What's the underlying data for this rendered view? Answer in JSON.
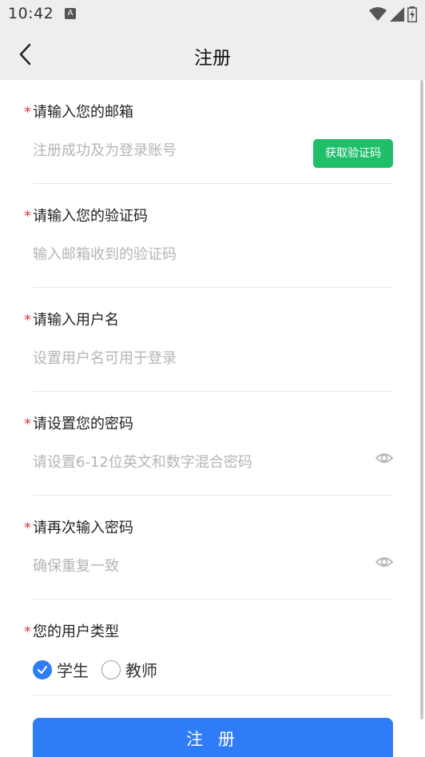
{
  "status_bar": {
    "time": "10:42",
    "notification_icon": "A"
  },
  "app_bar": {
    "title": "注册"
  },
  "form": {
    "required_mark": "*",
    "email": {
      "label": "请输入您的邮箱",
      "placeholder": "注册成功及为登录账号",
      "value": ""
    },
    "get_code_button": "获取验证码",
    "code": {
      "label": "请输入您的验证码",
      "placeholder": "输入邮箱收到的验证码",
      "value": ""
    },
    "username": {
      "label": "请输入用户名",
      "placeholder": "设置用户名可用于登录",
      "value": ""
    },
    "password": {
      "label": "请设置您的密码",
      "placeholder": "请设置6-12位英文和数字混合密码",
      "value": ""
    },
    "confirm": {
      "label": "请再次输入密码",
      "placeholder": "确保重复一致",
      "value": ""
    },
    "user_type": {
      "label": "您的用户类型",
      "options": [
        {
          "label": "学生",
          "checked": true
        },
        {
          "label": "教师",
          "checked": false
        }
      ]
    }
  },
  "submit_button": "注 册",
  "colors": {
    "accent": "#2f7df6",
    "code_button": "#1fbf6a",
    "required": "#e53935",
    "placeholder": "#b5b5b5",
    "bar_bg": "#eeeeee"
  },
  "icons": {
    "back": "chevron-left-icon",
    "eye": "eye-icon",
    "wifi": "wifi-icon",
    "signal": "signal-icon",
    "battery": "battery-icon"
  }
}
